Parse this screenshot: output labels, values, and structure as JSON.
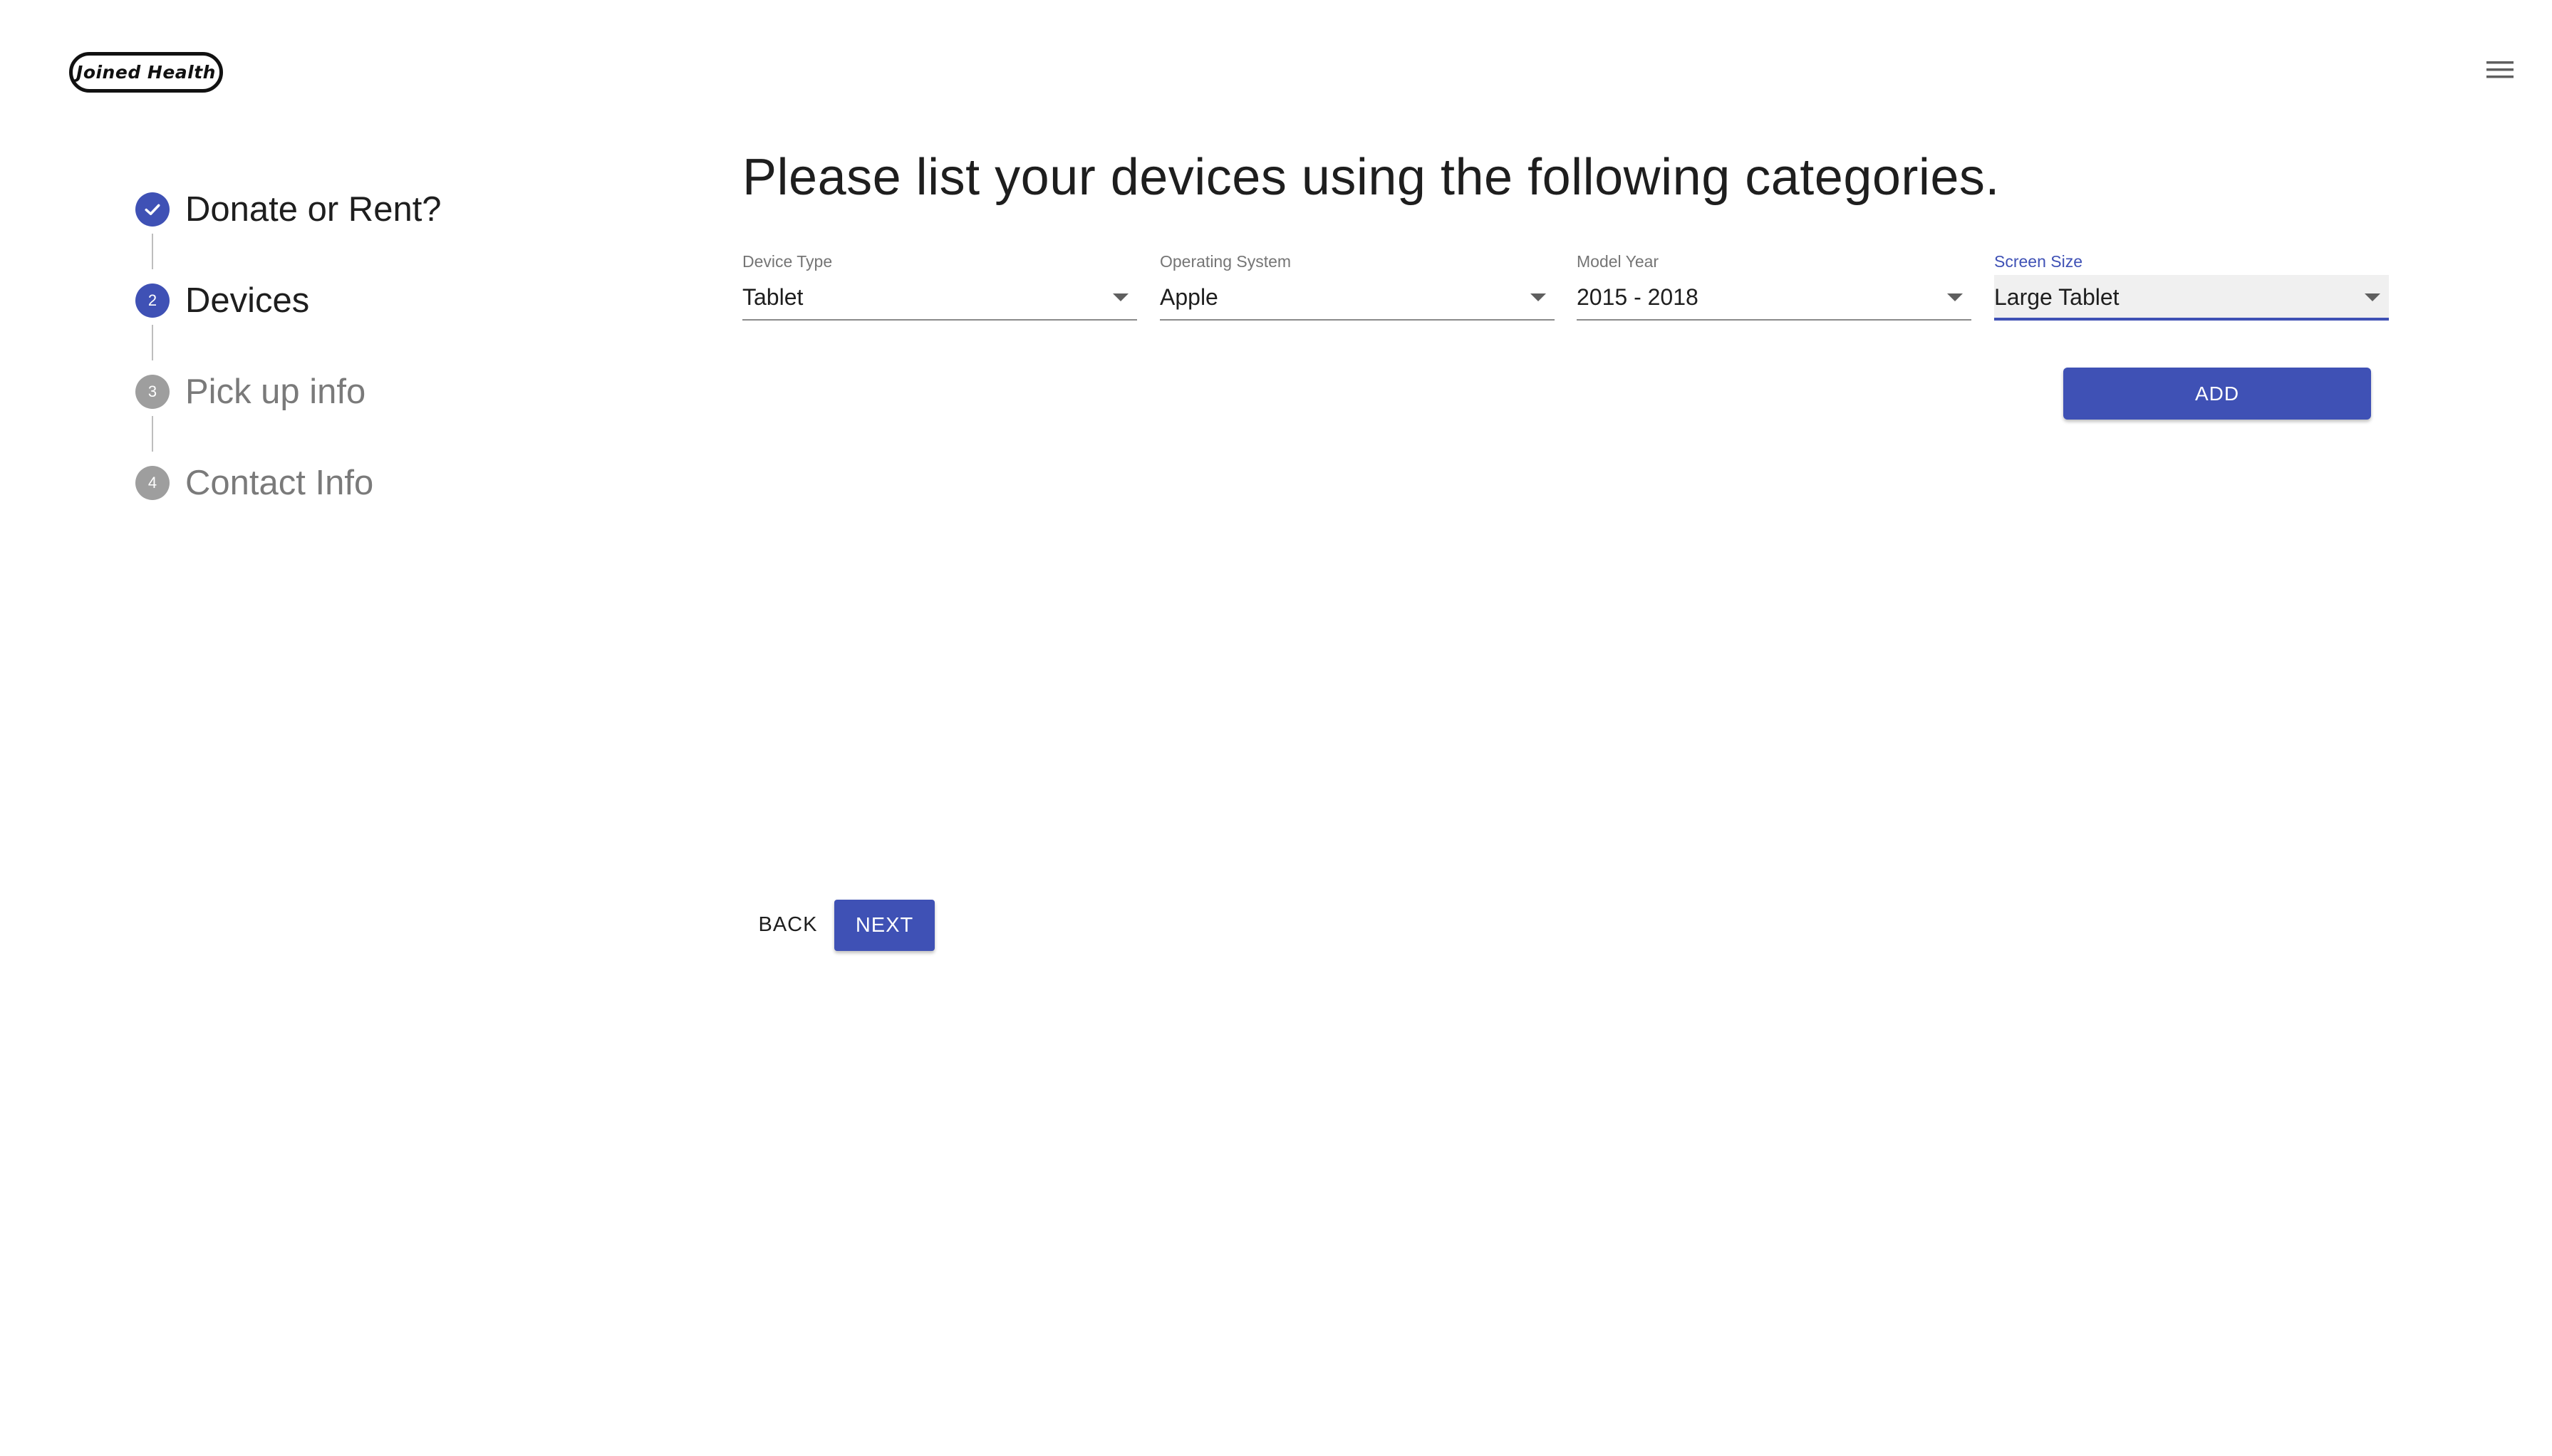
{
  "header": {
    "logo_text": "Joined Health",
    "menu_icon": "hamburger-menu-icon"
  },
  "stepper": {
    "steps": [
      {
        "label": "Donate or Rent?",
        "number": "1",
        "state": "completed",
        "icon": "check-icon"
      },
      {
        "label": "Devices",
        "number": "2",
        "state": "active"
      },
      {
        "label": "Pick up info",
        "number": "3",
        "state": "inactive"
      },
      {
        "label": "Contact Info",
        "number": "4",
        "state": "inactive"
      }
    ]
  },
  "main": {
    "heading": "Please list your devices using the following categories.",
    "fields": [
      {
        "label": "Device Type",
        "value": "Tablet",
        "focused": false
      },
      {
        "label": "Operating System",
        "value": "Apple",
        "focused": false
      },
      {
        "label": "Model Year",
        "value": "2015 - 2018",
        "focused": false
      },
      {
        "label": "Screen Size",
        "value": "Large Tablet",
        "focused": true
      }
    ],
    "add_label": "ADD"
  },
  "nav": {
    "back_label": "BACK",
    "next_label": "NEXT"
  },
  "colors": {
    "primary": "#3f51b5",
    "inactive_step": "#9e9e9e",
    "text": "#1e1e1e"
  }
}
